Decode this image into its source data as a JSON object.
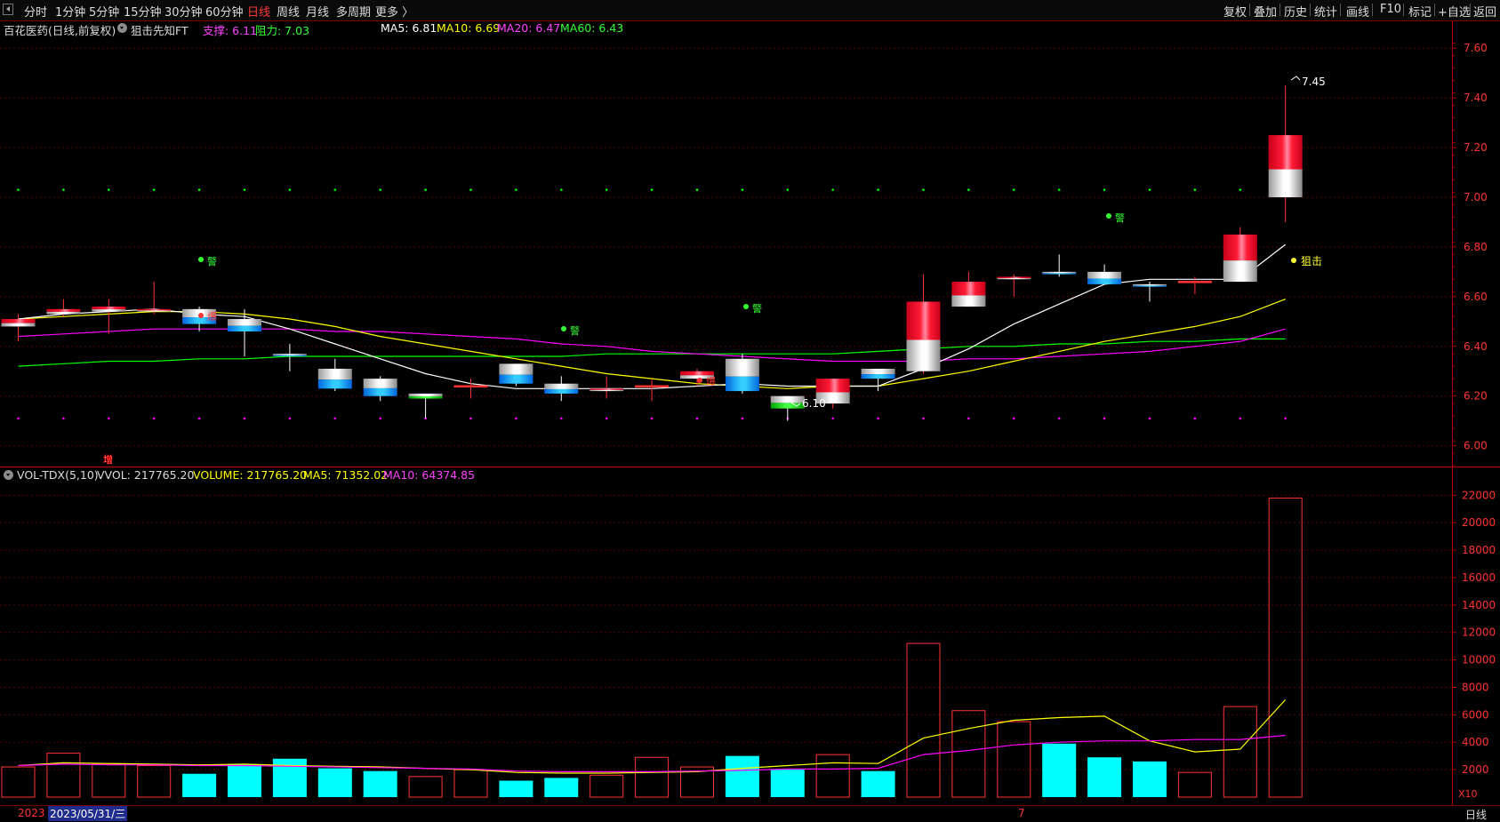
{
  "toolbar": {
    "periods": [
      "分时",
      "1分钟",
      "5分钟",
      "15分钟",
      "30分钟",
      "60分钟",
      "日线",
      "周线",
      "月线",
      "多周期",
      "更多 〉"
    ],
    "active_period": "日线",
    "right_buttons": [
      "复权",
      "叠加",
      "历史",
      "统计",
      "画线",
      "F10",
      "标记",
      "+自选",
      "返回"
    ]
  },
  "header": {
    "stock": "百花医药(日线,前复权)",
    "indicator": "狙击先知FT",
    "support": "支撑: 6.11",
    "resistance": "阻力: 7.03",
    "ma5": "MA5: 6.81",
    "ma10": "MA10: 6.69",
    "ma20": "MA20: 6.47",
    "ma60": "MA60: 6.43"
  },
  "vol_header": {
    "name": "VOL-TDX(5,10)",
    "vvol": "VVOL: 217765.20",
    "volume": "VOLUME: 217765.20",
    "ma5": "MA5: 71352.02",
    "ma10": "MA10: 64374.85"
  },
  "annotations": {
    "high": "7.45",
    "low": "6.10",
    "sniper": "狙击",
    "warn": "警",
    "burst": "爆",
    "add": "增",
    "multiplier": "X10"
  },
  "bottom": {
    "year": "2023",
    "date": "2023/05/31/三",
    "month_tick": "7",
    "mode": "日线"
  },
  "colors": {
    "up": "#ff3333",
    "down": "#00ffff",
    "ma5": "#ffffff",
    "ma10": "#ffff00",
    "ma20": "#ff00ff",
    "ma60": "#00ff00",
    "support": "#ff00ff",
    "resistance": "#00ff00"
  },
  "chart_data": [
    {
      "type": "candlestick",
      "ylim": [
        5.92,
        7.64
      ],
      "y_ticks": [
        "6.00",
        "6.20",
        "6.40",
        "6.60",
        "6.80",
        "7.00",
        "7.20",
        "7.40",
        "7.60"
      ],
      "candles": [
        {
          "o": 6.48,
          "c": 6.51,
          "h": 6.53,
          "l": 6.42
        },
        {
          "o": 6.53,
          "c": 6.55,
          "h": 6.59,
          "l": 6.52
        },
        {
          "o": 6.54,
          "c": 6.56,
          "h": 6.59,
          "l": 6.45
        },
        {
          "o": 6.54,
          "c": 6.55,
          "h": 6.66,
          "l": 6.53
        },
        {
          "o": 6.55,
          "c": 6.49,
          "h": 6.56,
          "l": 6.46
        },
        {
          "o": 6.51,
          "c": 6.46,
          "h": 6.55,
          "l": 6.36
        },
        {
          "o": 6.37,
          "c": 6.36,
          "h": 6.41,
          "l": 6.3
        },
        {
          "o": 6.31,
          "c": 6.23,
          "h": 6.35,
          "l": 6.22
        },
        {
          "o": 6.27,
          "c": 6.2,
          "h": 6.28,
          "l": 6.18
        },
        {
          "o": 6.21,
          "c": 6.19,
          "h": 6.21,
          "l": 6.11
        },
        {
          "o": 6.24,
          "c": 6.24,
          "h": 6.27,
          "l": 6.19
        },
        {
          "o": 6.33,
          "c": 6.25,
          "h": 6.33,
          "l": 6.24
        },
        {
          "o": 6.25,
          "c": 6.21,
          "h": 6.28,
          "l": 6.18
        },
        {
          "o": 6.22,
          "c": 6.23,
          "h": 6.28,
          "l": 6.19
        },
        {
          "o": 6.24,
          "c": 6.24,
          "h": 6.27,
          "l": 6.18
        },
        {
          "o": 6.27,
          "c": 6.3,
          "h": 6.31,
          "l": 6.24
        },
        {
          "o": 6.35,
          "c": 6.22,
          "h": 6.37,
          "l": 6.21
        },
        {
          "o": 6.2,
          "c": 6.15,
          "h": 6.2,
          "l": 6.1
        },
        {
          "o": 6.17,
          "c": 6.27,
          "h": 6.27,
          "l": 6.15
        },
        {
          "o": 6.31,
          "c": 6.27,
          "h": 6.31,
          "l": 6.22
        },
        {
          "o": 6.3,
          "c": 6.58,
          "h": 6.69,
          "l": 6.29
        },
        {
          "o": 6.56,
          "c": 6.66,
          "h": 6.7,
          "l": 6.56
        },
        {
          "o": 6.67,
          "c": 6.68,
          "h": 6.69,
          "l": 6.6
        },
        {
          "o": 6.7,
          "c": 6.69,
          "h": 6.77,
          "l": 6.68
        },
        {
          "o": 6.7,
          "c": 6.65,
          "h": 6.73,
          "l": 6.65
        },
        {
          "o": 6.65,
          "c": 6.64,
          "h": 6.66,
          "l": 6.58
        },
        {
          "o": 6.66,
          "c": 6.66,
          "h": 6.68,
          "l": 6.61
        },
        {
          "o": 6.66,
          "c": 6.85,
          "h": 6.88,
          "l": 6.66
        },
        {
          "o": 7.0,
          "c": 7.25,
          "h": 7.45,
          "l": 6.9
        }
      ],
      "ma5": [
        6.51,
        6.53,
        6.54,
        6.55,
        6.53,
        6.52,
        6.47,
        6.41,
        6.35,
        6.29,
        6.25,
        6.23,
        6.23,
        6.23,
        6.23,
        6.24,
        6.25,
        6.24,
        6.24,
        6.24,
        6.31,
        6.39,
        6.49,
        6.57,
        6.65,
        6.67,
        6.67,
        6.67,
        6.81
      ],
      "ma10": [
        6.51,
        6.52,
        6.53,
        6.54,
        6.54,
        6.53,
        6.51,
        6.48,
        6.44,
        6.41,
        6.38,
        6.35,
        6.32,
        6.29,
        6.27,
        6.25,
        6.24,
        6.23,
        6.24,
        6.24,
        6.27,
        6.3,
        6.34,
        6.38,
        6.42,
        6.45,
        6.48,
        6.52,
        6.59,
        6.69
      ],
      "ma20": [
        6.44,
        6.45,
        6.46,
        6.47,
        6.47,
        6.47,
        6.47,
        6.46,
        6.46,
        6.45,
        6.44,
        6.43,
        6.41,
        6.4,
        6.38,
        6.37,
        6.36,
        6.35,
        6.34,
        6.34,
        6.34,
        6.35,
        6.35,
        6.36,
        6.37,
        6.38,
        6.4,
        6.42,
        6.47
      ],
      "ma60": [
        6.32,
        6.33,
        6.34,
        6.34,
        6.35,
        6.35,
        6.36,
        6.36,
        6.36,
        6.36,
        6.36,
        6.36,
        6.36,
        6.37,
        6.37,
        6.37,
        6.37,
        6.37,
        6.37,
        6.38,
        6.39,
        6.4,
        6.4,
        6.41,
        6.41,
        6.42,
        6.42,
        6.43,
        6.43
      ],
      "resistance": 7.03,
      "support": 6.11
    },
    {
      "type": "bar",
      "ylim": [
        0,
        22800
      ],
      "y_ticks": [
        "2000",
        "4000",
        "6000",
        "8000",
        "10000",
        "12000",
        "14000",
        "16000",
        "18000",
        "20000",
        "22000"
      ],
      "values": [
        2200,
        3200,
        2400,
        2300,
        1700,
        2400,
        2800,
        2100,
        1900,
        1500,
        2000,
        1200,
        1400,
        1600,
        2900,
        2200,
        3000,
        2000,
        3100,
        1900,
        11200,
        6300,
        5500,
        3900,
        2900,
        2600,
        1800,
        6600,
        21800
      ],
      "up": [
        true,
        true,
        true,
        true,
        false,
        false,
        false,
        false,
        false,
        true,
        true,
        false,
        false,
        true,
        true,
        true,
        false,
        false,
        true,
        false,
        true,
        true,
        true,
        false,
        false,
        false,
        true,
        true,
        true
      ],
      "ma5": [
        2300,
        2500,
        2450,
        2400,
        2350,
        2400,
        2300,
        2250,
        2200,
        2100,
        2000,
        1800,
        1750,
        1750,
        1800,
        1850,
        2100,
        2300,
        2500,
        2450,
        4300,
        5000,
        5600,
        5800,
        5900,
        4100,
        3300,
        3500,
        7100
      ],
      "ma10": [
        2300,
        2400,
        2350,
        2350,
        2300,
        2300,
        2250,
        2200,
        2150,
        2100,
        2050,
        1900,
        1850,
        1850,
        1850,
        1900,
        1950,
        2050,
        2050,
        2100,
        3100,
        3400,
        3800,
        4000,
        4100,
        4100,
        4200,
        4200,
        4500,
        6400
      ]
    }
  ]
}
